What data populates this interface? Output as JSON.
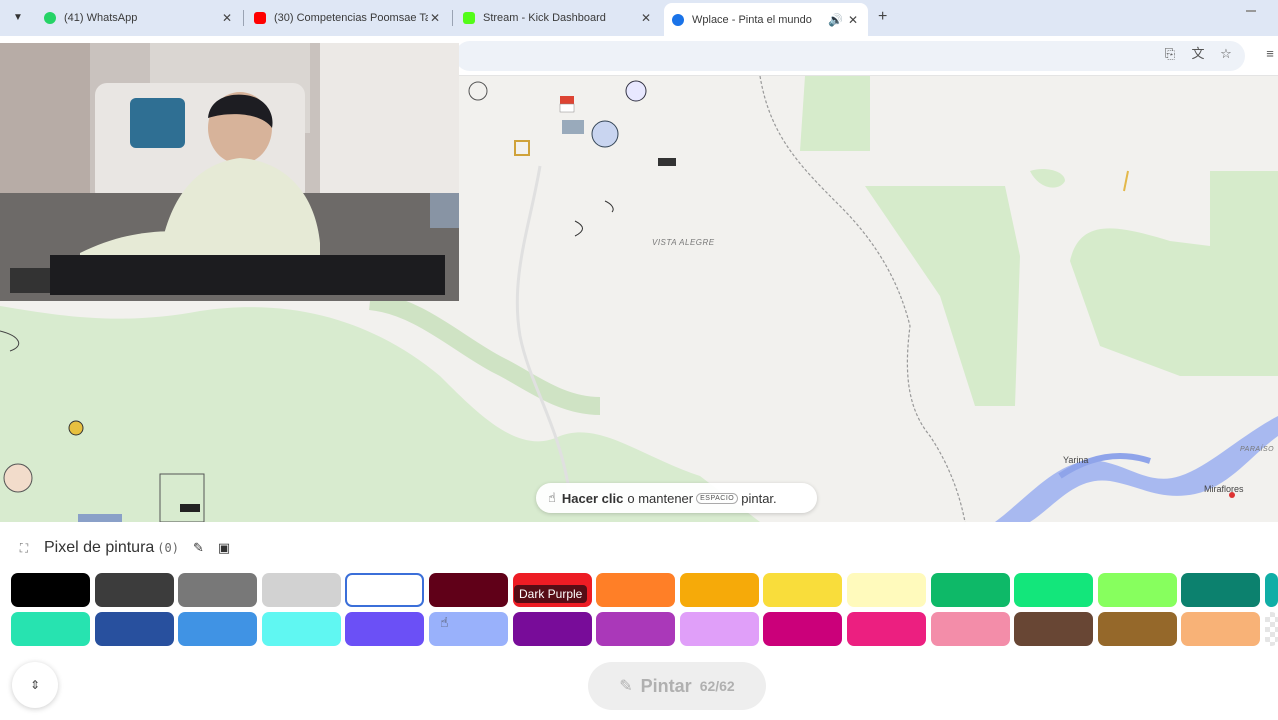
{
  "browser": {
    "tabs": [
      {
        "title": "(41) WhatsApp",
        "icon": "whatsapp-icon",
        "color": "#25d366"
      },
      {
        "title": "(30) Competencias Poomsae Ta",
        "icon": "youtube-icon",
        "color": "#ff0000"
      },
      {
        "title": "Stream - Kick Dashboard",
        "icon": "kick-icon",
        "color": "#53fc18"
      },
      {
        "title": "Wplace - Pinta el mundo",
        "icon": "globe-icon",
        "color": "#1a73e8"
      }
    ]
  },
  "map": {
    "place_vista_alegre": "VISTA ALEGRE",
    "city_yarina": "Yarina",
    "city_miraflores": "Miraflores",
    "place_paraiso": "PARAÍSO",
    "hint": {
      "action": "Hacer clic",
      "middle": "o mantener",
      "key": "ESPACIO",
      "end": "pintar."
    }
  },
  "panel": {
    "title": "Pixel de pintura",
    "count": "(0)",
    "tooltip": "Dark Purple",
    "paint_label": "Pintar",
    "paint_count": "62/62",
    "palette_row1": [
      "#000000",
      "#3c3c3c",
      "#787878",
      "#d2d2d2",
      "#ffffff",
      "#600018",
      "#ed1c24",
      "#ff7f27",
      "#f6aa09",
      "#f9dd3b",
      "#fffabc",
      "#0eb968",
      "#13e67b",
      "#87ff5e",
      "#0c816e",
      "#10aea6"
    ],
    "palette_row2": [
      "#27e3b0",
      "#28509e",
      "#4093e4",
      "#60f7f2",
      "#6b50f6",
      "#99b1fb",
      "#780c99",
      "#aa38b9",
      "#e09ff9",
      "#cb007a",
      "#ec1f80",
      "#f38da9",
      "#684634",
      "#95682a",
      "#f8b277",
      "#cccccc"
    ]
  }
}
